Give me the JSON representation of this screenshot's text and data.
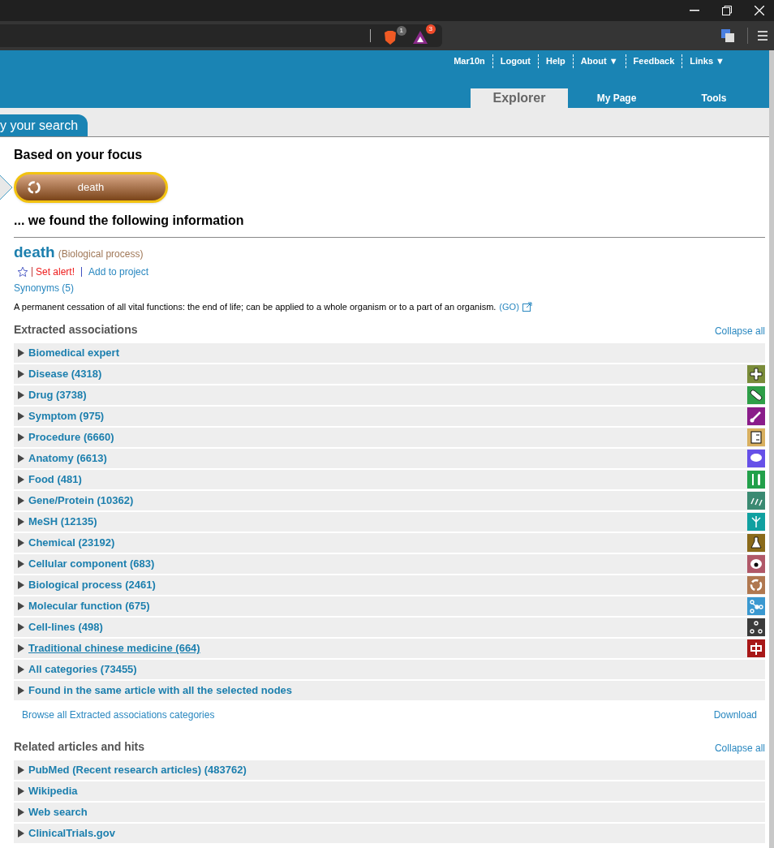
{
  "browser": {
    "badges": [
      "1",
      "3"
    ]
  },
  "header": {
    "user_links": [
      {
        "label": "Mar10n"
      },
      {
        "label": "Logout"
      },
      {
        "label": "Help"
      },
      {
        "label": "About ▼"
      },
      {
        "label": "Feedback"
      },
      {
        "label": "Links ▼"
      }
    ],
    "tabs": [
      {
        "label": "Explorer",
        "selected": true
      },
      {
        "label": "My Page",
        "selected": false
      },
      {
        "label": "Tools",
        "selected": false
      }
    ]
  },
  "search_tab": "y your search",
  "focus": {
    "heading": "Based on your focus",
    "chip": "death"
  },
  "results_heading": "... we found the following information",
  "concept": {
    "name": "death",
    "type": "(Biological process)",
    "set_alert": "Set alert!",
    "add_to_project": "Add to project",
    "synonyms": "Synonyms (5)",
    "definition": "A permanent cessation of all vital functions: the end of life; can be applied to a whole organism or to a part of an organism.",
    "go_link": "(GO)"
  },
  "extracted": {
    "title": "Extracted associations",
    "collapse": "Collapse all",
    "rows": [
      {
        "label": "Biomedical expert",
        "kind": "none",
        "hovered": false
      },
      {
        "label": "Disease (4318)",
        "kind": "disease",
        "color": "#7a8c3a",
        "hovered": false
      },
      {
        "label": "Drug (3738)",
        "kind": "drug",
        "color": "#2e9e48",
        "hovered": false
      },
      {
        "label": "Symptom (975)",
        "kind": "symptom",
        "color": "#8a1c8a",
        "hovered": false
      },
      {
        "label": "Procedure (6660)",
        "kind": "procedure",
        "color": "#d9b060",
        "hovered": false
      },
      {
        "label": "Anatomy (6613)",
        "kind": "anatomy",
        "color": "#6650e8",
        "hovered": false
      },
      {
        "label": "Food (481)",
        "kind": "food",
        "color": "#22a04a",
        "hovered": false
      },
      {
        "label": "Gene/Protein (10362)",
        "kind": "gene",
        "color": "#3a8a72",
        "hovered": false
      },
      {
        "label": "MeSH (12135)",
        "kind": "mesh",
        "color": "#10a0a0",
        "hovered": false
      },
      {
        "label": "Chemical (23192)",
        "kind": "chemical",
        "color": "#8a6a1a",
        "hovered": false
      },
      {
        "label": "Cellular component (683)",
        "kind": "cell",
        "color": "#b05868",
        "hovered": false
      },
      {
        "label": "Biological process (2461)",
        "kind": "process",
        "color": "#b07850",
        "hovered": false
      },
      {
        "label": "Molecular function (675)",
        "kind": "molecular",
        "color": "#3a98d0",
        "hovered": false
      },
      {
        "label": "Cell-lines (498)",
        "kind": "cellline",
        "color": "#3a3a3a",
        "hovered": false
      },
      {
        "label": "Traditional chinese medicine (664)",
        "kind": "tcm",
        "color": "#a81818",
        "hovered": true
      },
      {
        "label": "All categories (73455)",
        "kind": "none",
        "hovered": false
      },
      {
        "label": "Found in the same article with all the selected nodes",
        "kind": "none",
        "hovered": false
      }
    ],
    "browse": "Browse all Extracted associations categories",
    "download": "Download"
  },
  "related": {
    "title": "Related articles and hits",
    "collapse": "Collapse all",
    "rows": [
      {
        "label": "PubMed (Recent research articles) (483762)",
        "hovered": false
      },
      {
        "label": "Wikipedia",
        "hovered": false
      },
      {
        "label": "Web search",
        "hovered": false
      },
      {
        "label": "ClinicalTrials.gov",
        "hovered": false
      }
    ]
  }
}
